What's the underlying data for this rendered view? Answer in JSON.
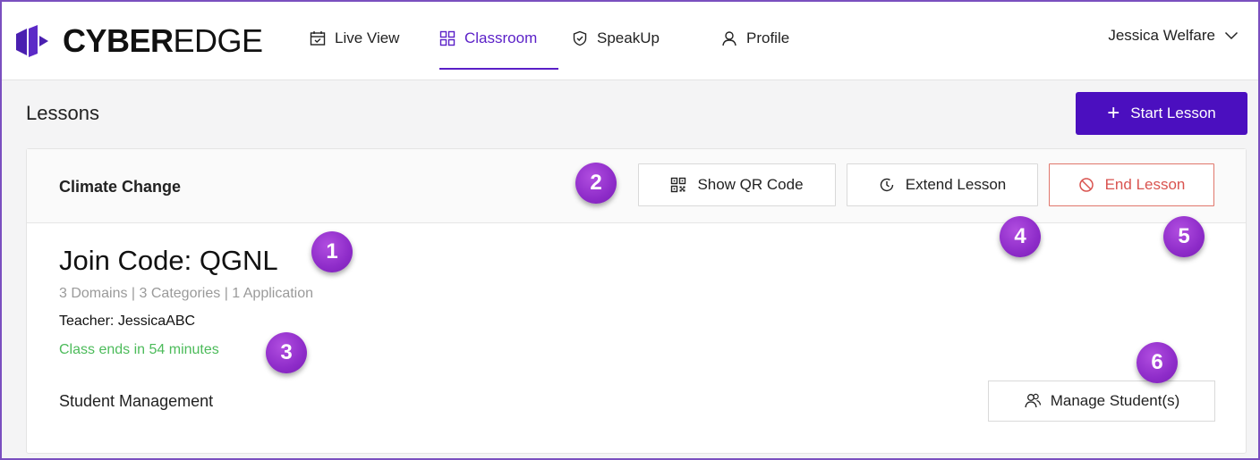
{
  "brand": {
    "name_bold": "CYBER",
    "name_regular": "EDGE"
  },
  "nav": {
    "items": [
      {
        "label": "Live View",
        "icon": "calendar-check-icon"
      },
      {
        "label": "Classroom",
        "icon": "grid-icon",
        "active": true
      },
      {
        "label": "SpeakUp",
        "icon": "shield-check-icon"
      },
      {
        "label": "Profile",
        "icon": "user-icon"
      }
    ],
    "user_name": "Jessica Welfare"
  },
  "page": {
    "title": "Lessons",
    "start_lesson_label": "Start Lesson"
  },
  "lesson": {
    "title": "Climate Change",
    "show_qr_label": "Show QR Code",
    "extend_label": "Extend Lesson",
    "end_label": "End Lesson",
    "join_code": "Join Code: QGNL",
    "meta": "3 Domains  |  3 Categories  |  1 Application",
    "teacher": "Teacher:  JessicaABC",
    "class_ends": "Class ends in 54 minutes",
    "student_management": "Student Management",
    "manage_students_label": "Manage Student(s)"
  },
  "callouts": [
    "1",
    "2",
    "3",
    "4",
    "5",
    "6"
  ],
  "colors": {
    "accent": "#5a1fc7",
    "primary_button": "#4b0fbf",
    "danger": "#d9534f",
    "success": "#4cbb5a",
    "callout": "#8e2cc9",
    "frame_border": "#7a4fbf"
  }
}
